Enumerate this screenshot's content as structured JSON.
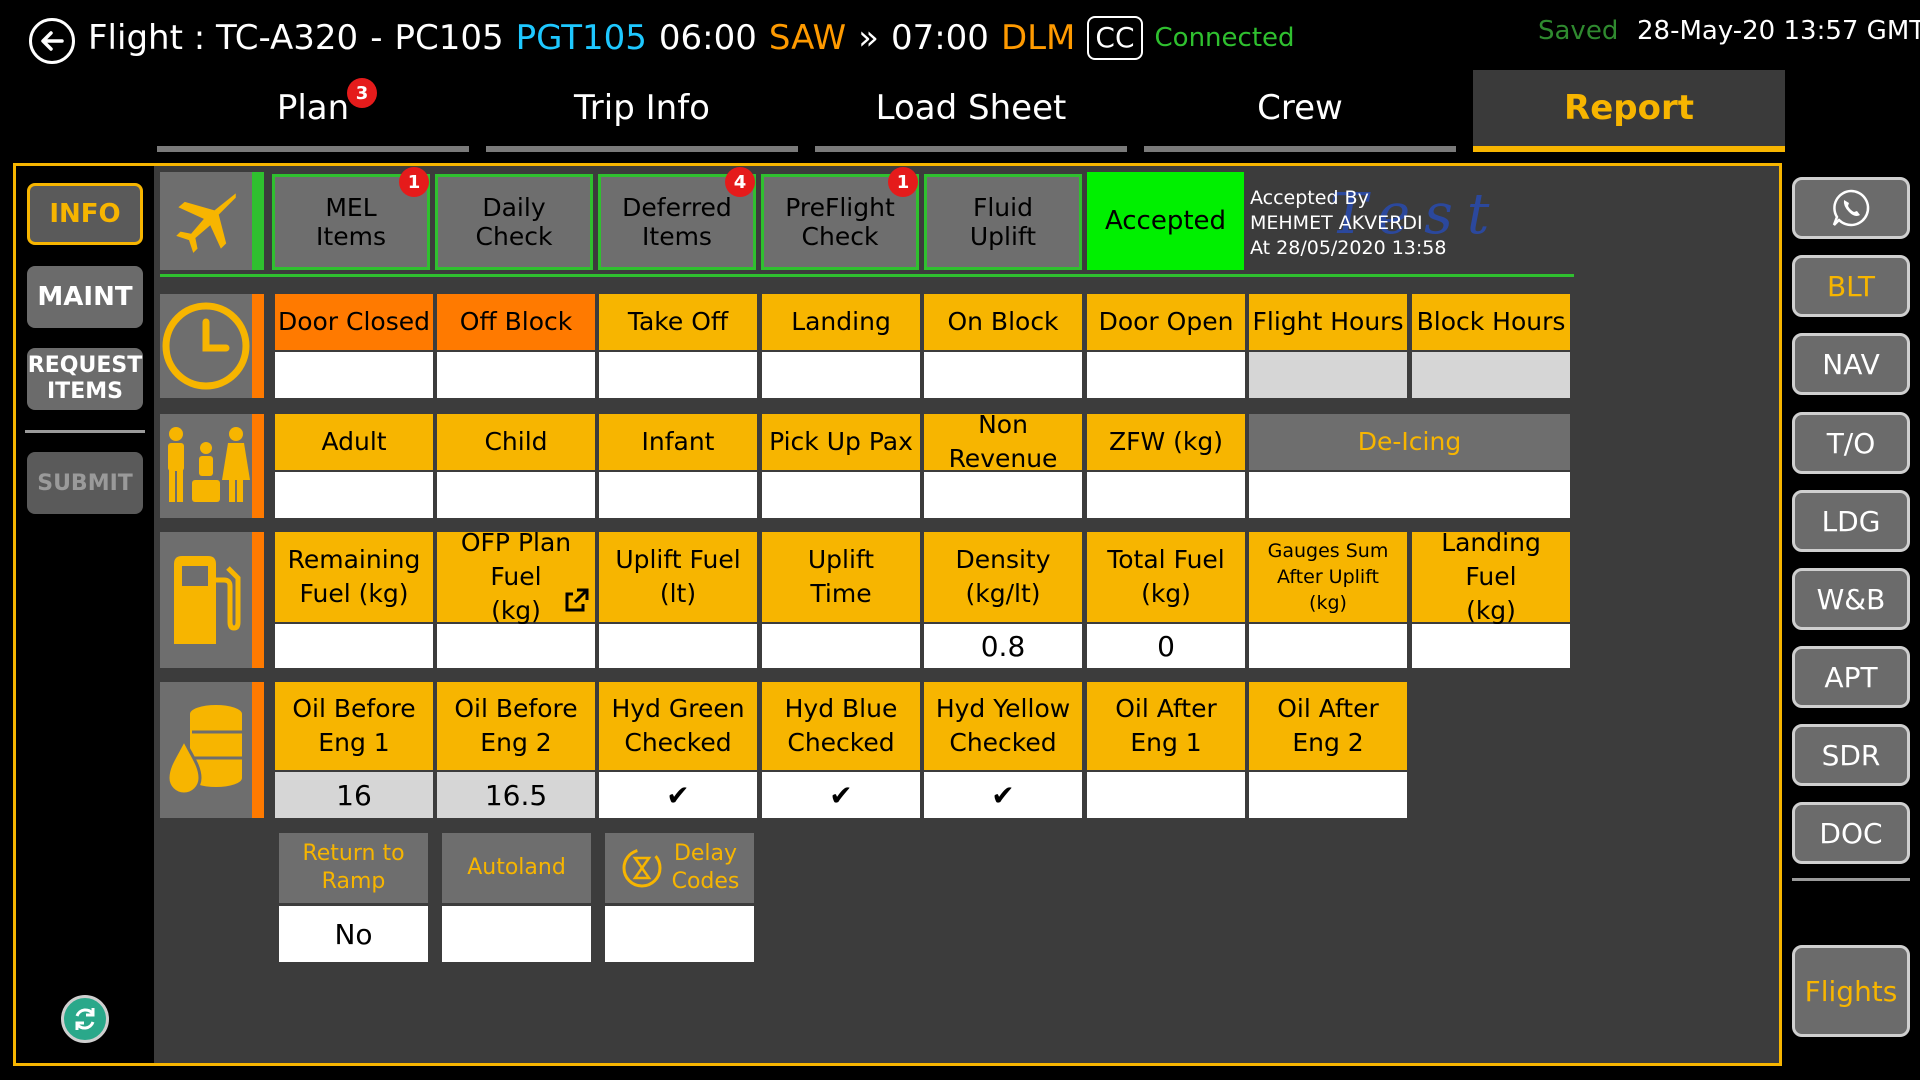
{
  "header": {
    "prefix": "Flight : TC-A320",
    "dash": "-",
    "flight_no": "PC105",
    "callsign": "PGT105",
    "dep_time": "06:00",
    "dep_apt": "SAW",
    "arrow": "»",
    "arr_time": "07:00",
    "arr_apt": "DLM",
    "cc": "CC",
    "connection": "Connected",
    "saved": "Saved",
    "datetime": "28-May-20 13:57 GMT"
  },
  "tabs": [
    {
      "label": "Plan",
      "badge": "3"
    },
    {
      "label": "Trip Info"
    },
    {
      "label": "Load Sheet"
    },
    {
      "label": "Crew"
    },
    {
      "label": "Report",
      "active": true
    }
  ],
  "left_nav": {
    "info": "INFO",
    "maint": "MAINT",
    "request_1": "REQUEST",
    "request_2": "ITEMS",
    "submit": "SUBMIT"
  },
  "status_row": {
    "items": [
      {
        "l1": "MEL",
        "l2": "Items",
        "badge": "1"
      },
      {
        "l1": "Daily",
        "l2": "Check"
      },
      {
        "l1": "Deferred",
        "l2": "Items",
        "badge": "4"
      },
      {
        "l1": "PreFlight",
        "l2": "Check",
        "badge": "1"
      },
      {
        "l1": "Fluid",
        "l2": "Uplift"
      }
    ],
    "accepted": "Accepted",
    "accepted_by_label": "Accepted By",
    "accepted_by_name": "MEHMET AKVERDI",
    "accepted_at": "At 28/05/2020 13:58"
  },
  "times": {
    "headers": [
      "Door Closed",
      "Off Block",
      "Take Off",
      "Landing",
      "On Block",
      "Door Open",
      "Flight Hours",
      "Block Hours"
    ],
    "values": [
      "",
      "",
      "",
      "",
      "",
      "",
      "",
      ""
    ]
  },
  "pax": {
    "headers": [
      "Adult",
      "Child",
      "Infant",
      "Pick Up Pax",
      "Non Revenue",
      "ZFW (kg)"
    ],
    "deicing": "De-Icing",
    "values": [
      "",
      "",
      "",
      "",
      "",
      "",
      ""
    ]
  },
  "fuel": {
    "headers": [
      {
        "l1": "Remaining",
        "l2": "Fuel (kg)"
      },
      {
        "l1": "OFP Plan Fuel",
        "l2": "(kg)"
      },
      {
        "l1": "Uplift Fuel",
        "l2": "(lt)"
      },
      {
        "l1": "Uplift",
        "l2": "Time"
      },
      {
        "l1": "Density",
        "l2": "(kg/lt)"
      },
      {
        "l1": "Total Fuel",
        "l2": "(kg)"
      },
      {
        "l1": "Gauges Sum",
        "l2": "After Uplift",
        "l3": "(kg)"
      },
      {
        "l1": "Landing Fuel",
        "l2": "(kg)"
      }
    ],
    "values": [
      "",
      "",
      "",
      "",
      "0.8",
      "0",
      "",
      ""
    ]
  },
  "oil": {
    "headers": [
      {
        "l1": "Oil Before",
        "l2": "Eng 1"
      },
      {
        "l1": "Oil Before",
        "l2": "Eng 2"
      },
      {
        "l1": "Hyd Green",
        "l2": "Checked"
      },
      {
        "l1": "Hyd Blue",
        "l2": "Checked"
      },
      {
        "l1": "Hyd Yellow",
        "l2": "Checked"
      },
      {
        "l1": "Oil After",
        "l2": "Eng 1"
      },
      {
        "l1": "Oil After",
        "l2": "Eng 2"
      }
    ],
    "values": [
      "16",
      "16.5",
      "✔",
      "✔",
      "✔",
      "",
      ""
    ]
  },
  "extras": [
    {
      "l1": "Return to",
      "l2": "Ramp",
      "value": "No"
    },
    {
      "l1": "Autoland",
      "l2": "",
      "value": ""
    },
    {
      "l1": "Delay",
      "l2": "Codes",
      "value": ""
    }
  ],
  "right_nav": [
    "BLT",
    "NAV",
    "T/O",
    "LDG",
    "W&B",
    "APT",
    "SDR",
    "DOC"
  ],
  "flights": "Flights",
  "colors": {
    "accent": "#f7b500",
    "orange": "#ff7a00",
    "green": "#2fc02f",
    "cyan": "#1ec8ff",
    "badge": "#e51b1b"
  }
}
